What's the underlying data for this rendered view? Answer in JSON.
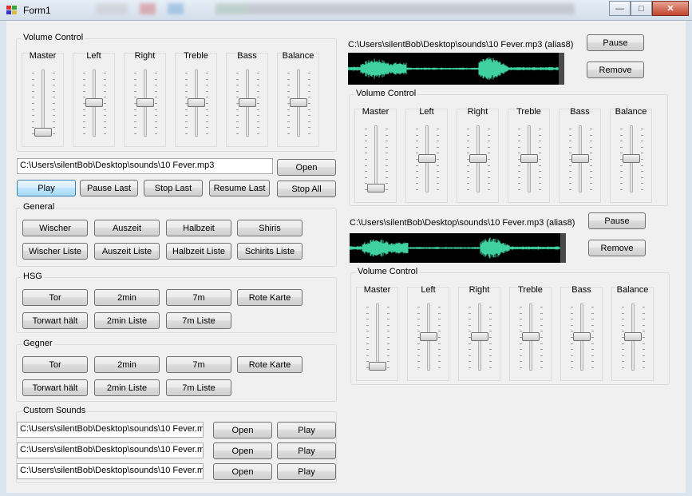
{
  "window": {
    "title": "Form1",
    "minimize": "—",
    "maximize": "□",
    "close": "✕"
  },
  "left": {
    "volume": {
      "title": "Volume Control",
      "sliders": [
        {
          "label": "Master",
          "level": 0.0
        },
        {
          "label": "Left",
          "level": 0.5
        },
        {
          "label": "Right",
          "level": 0.5
        },
        {
          "label": "Treble",
          "level": 0.5
        },
        {
          "label": "Bass",
          "level": 0.5
        },
        {
          "label": "Balance",
          "level": 0.5
        }
      ]
    },
    "file_path": "C:\\Users\\silentBob\\Desktop\\sounds\\10 Fever.mp3",
    "open_label": "Open",
    "transport": [
      "Play",
      "Pause Last",
      "Stop Last",
      "Resume Last",
      "Stop All"
    ],
    "general": {
      "title": "General",
      "row1": [
        "Wischer",
        "Auszeit",
        "Halbzeit",
        "Shiris"
      ],
      "row2": [
        "Wischer Liste",
        "Auszeit Liste",
        "Halbzeit Liste",
        "Schirits Liste"
      ]
    },
    "hsg": {
      "title": "HSG",
      "row1": [
        "Tor",
        "2min",
        "7m",
        "Rote Karte"
      ],
      "row2": [
        "Torwart hält",
        "2min Liste",
        "7m Liste"
      ]
    },
    "gegner": {
      "title": "Gegner",
      "row1": [
        "Tor",
        "2min",
        "7m",
        "Rote Karte"
      ],
      "row2": [
        "Torwart hält",
        "2min Liste",
        "7m Liste"
      ]
    },
    "custom": {
      "title": "Custom Sounds",
      "rows": [
        {
          "path": "C:\\Users\\silentBob\\Desktop\\sounds\\10 Fever.m",
          "open": "Open",
          "play": "Play"
        },
        {
          "path": "C:\\Users\\silentBob\\Desktop\\sounds\\10 Fever.m",
          "open": "Open",
          "play": "Play"
        },
        {
          "path": "C:\\Users\\silentBob\\Desktop\\sounds\\10 Fever.m",
          "open": "Open",
          "play": "Play"
        }
      ]
    }
  },
  "players": [
    {
      "file_label": "C:\\Users\\silentBob\\Desktop\\sounds\\10 Fever.mp3 (alias8)",
      "pause": "Pause",
      "remove": "Remove",
      "volume_title": "Volume Control",
      "sliders": [
        {
          "label": "Master",
          "level": 0.0
        },
        {
          "label": "Left",
          "level": 0.5
        },
        {
          "label": "Right",
          "level": 0.5
        },
        {
          "label": "Treble",
          "level": 0.5
        },
        {
          "label": "Bass",
          "level": 0.5
        },
        {
          "label": "Balance",
          "level": 0.5
        }
      ]
    },
    {
      "file_label": "C:\\Users\\silentBob\\Desktop\\sounds\\10 Fever.mp3 (alias8)",
      "pause": "Pause",
      "remove": "Remove",
      "volume_title": "Volume Control",
      "sliders": [
        {
          "label": "Master",
          "level": 0.0
        },
        {
          "label": "Left",
          "level": 0.5
        },
        {
          "label": "Right",
          "level": 0.5
        },
        {
          "label": "Treble",
          "level": 0.5
        },
        {
          "label": "Bass",
          "level": 0.5
        },
        {
          "label": "Balance",
          "level": 0.5
        }
      ]
    }
  ],
  "colors": {
    "waveform": "#3fd1a0",
    "waveform_bg": "#000000",
    "focus_border": "#3c7fb1"
  }
}
